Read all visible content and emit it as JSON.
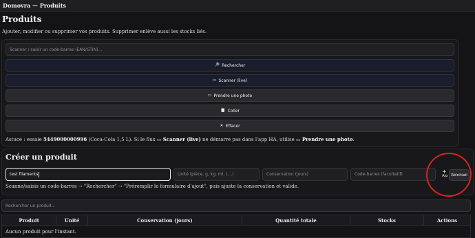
{
  "app": {
    "window_title": "Domovra — Produits"
  },
  "page": {
    "title": "Produits",
    "description": "Ajouter, modifier ou supprimer vos produits. Supprimer enlève aussi les stocks liés."
  },
  "scanner": {
    "input_placeholder": "Scanner / saisir un code-barres (EAN/GTIN)...",
    "buttons": {
      "search": {
        "icon": "🔎",
        "label": "Rechercher"
      },
      "scan_live": {
        "icon": "▭",
        "label": "Scanner (live)"
      },
      "photo": {
        "icon": "▭",
        "label": "Prendre une photo"
      },
      "paste": {
        "icon": "📋",
        "label": "Coller"
      },
      "clear": {
        "icon": "✕",
        "label": "Effacer"
      }
    },
    "tip": {
      "prefix": "Astuce : essaie ",
      "code": "5449000000996",
      "middle": " (Coca-Cola 1,5 L). Si le flux ",
      "scan_icon": "▭",
      "scan_label": "Scanner (live)",
      "middle2": " ne démarre pas dans l'app HA, utilise ",
      "photo_icon": "▭",
      "photo_label": "Prendre une photo",
      "suffix": "."
    }
  },
  "create": {
    "title": "Créer un produit",
    "name_value": "test filaments",
    "unit_placeholder": "Unité (pièce, g, kg, ml, L...)",
    "conservation_placeholder": "Conservation (jours)",
    "barcode_placeholder": "Code-barres (facultatif)",
    "add_icon": "+",
    "add_label": "Ajo",
    "reset_label": "Réinitiali",
    "help_text": "Scanne/saisis un code-barres → \"Rechercher\" → \"Préremplir le formulaire d'ajout\", puis ajuste la conservation et valide."
  },
  "products": {
    "search_placeholder": "Rechercher un produit...",
    "columns": [
      "Produit",
      "Unité",
      "Conservation (jours)",
      "Quantité totale",
      "Stocks",
      "Actions"
    ],
    "empty_text": "Aucun produit pour l'instant."
  },
  "colors": {
    "annotation_circle": "#d8241f",
    "background": "#141416"
  }
}
